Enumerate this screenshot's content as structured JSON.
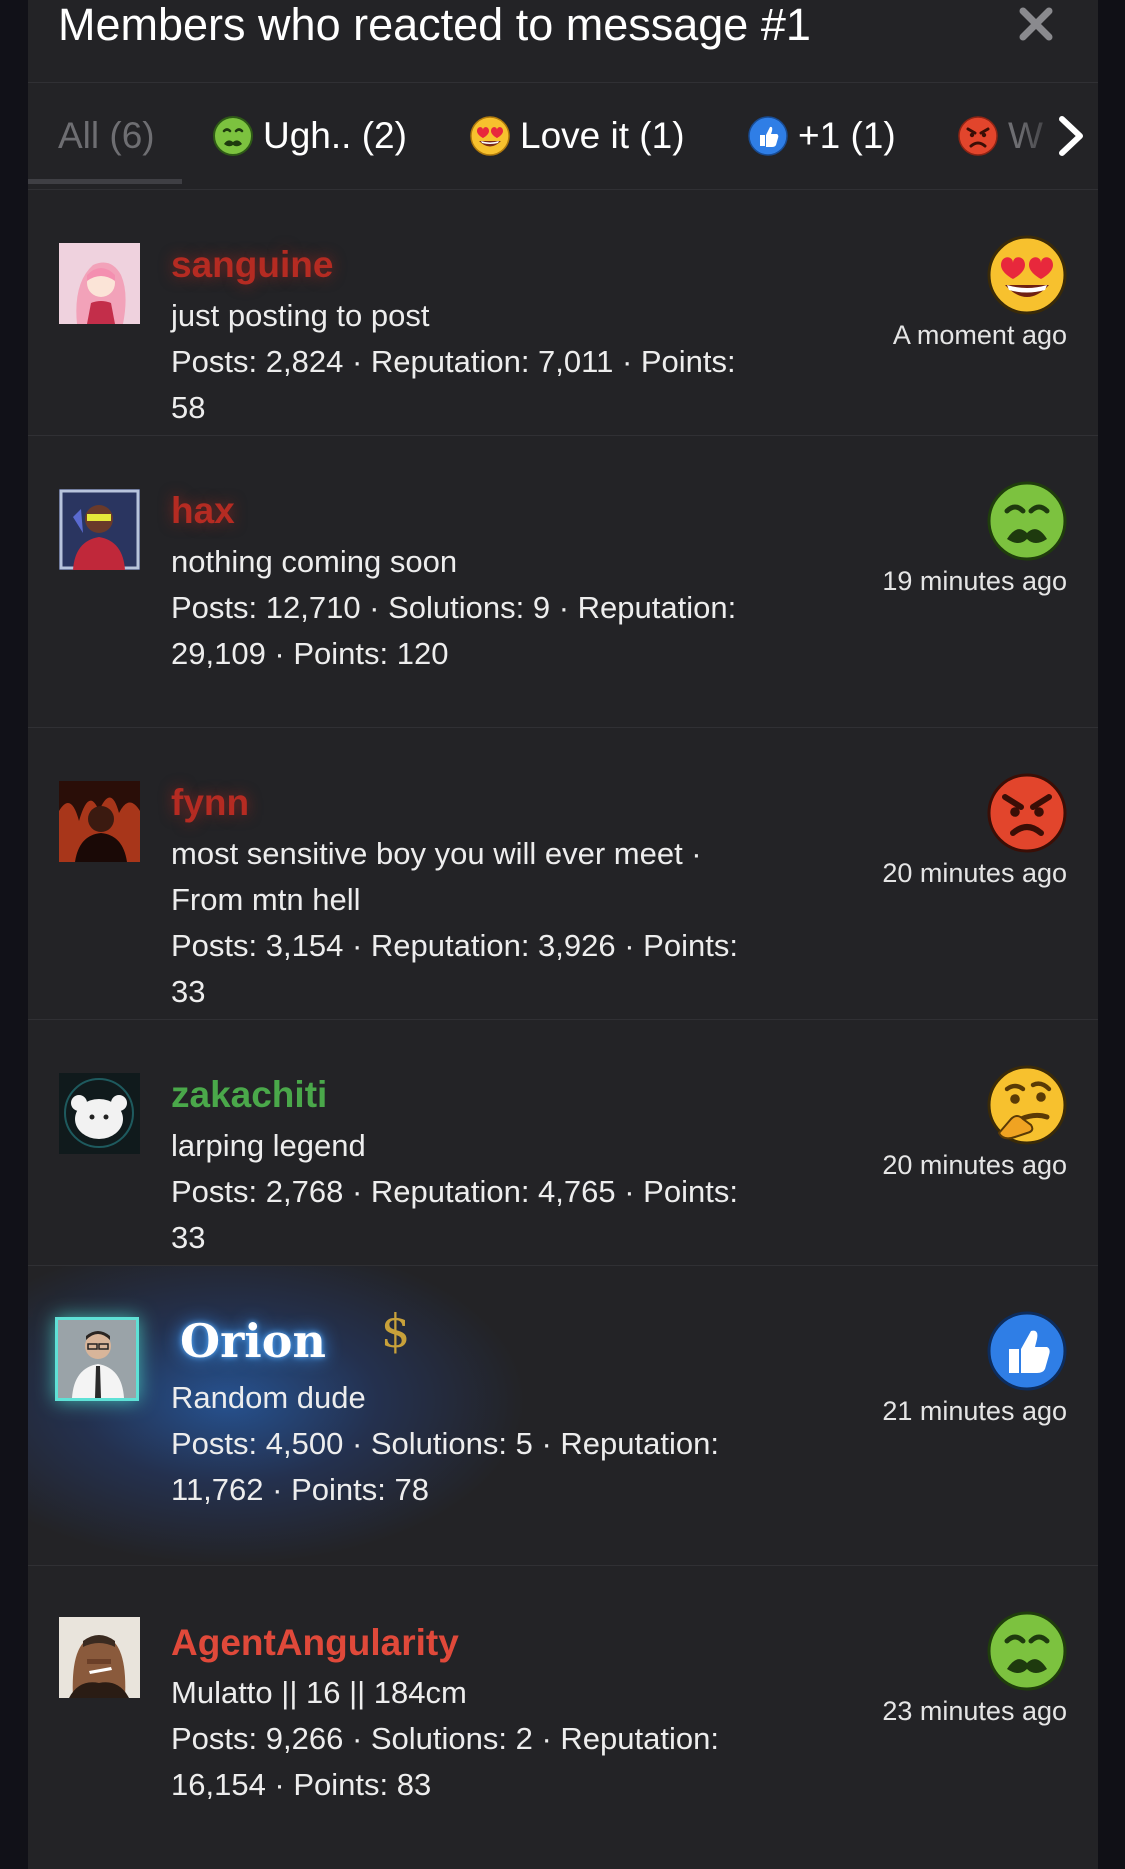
{
  "modal": {
    "title": "Members who reacted to message #1"
  },
  "tabs": [
    {
      "label": "All (6)",
      "icon": "all",
      "active": true
    },
    {
      "label": "Ugh.. (2)",
      "icon": "sick-face-icon"
    },
    {
      "label": "Love it (1)",
      "icon": "heart-eyes-icon"
    },
    {
      "label": "+1 (1)",
      "icon": "thumbs-up-icon"
    },
    {
      "label": "W",
      "icon": "angry-face-icon"
    }
  ],
  "members": [
    {
      "username": "sanguine",
      "title": "just posting to post",
      "stats": "Posts: 2,824 · Reputation: 7,011 · Points: 58",
      "time": "A moment ago",
      "reaction": "heart-eyes-icon",
      "name_color": "#b52b22"
    },
    {
      "username": "hax",
      "title": "nothing coming soon",
      "stats": "Posts: 12,710 · Solutions: 9 · Reputation: 29,109 · Points: 120",
      "time": "19 minutes ago",
      "reaction": "sick-face-icon",
      "name_color": "#b52b22"
    },
    {
      "username": "fynn",
      "title": "most sensitive boy you will ever meet · From mtn hell",
      "stats": "Posts: 3,154 · Reputation: 3,926 · Points: 33",
      "time": "20 minutes ago",
      "reaction": "angry-face-icon",
      "name_color": "#b52b22"
    },
    {
      "username": "zakachiti",
      "title": "larping legend",
      "stats": "Posts: 2,768 · Reputation: 4,765 · Points: 33",
      "time": "20 minutes ago",
      "reaction": "thinking-face-icon",
      "name_color": "#4aa84a"
    },
    {
      "username": "Orion",
      "title": "Random dude",
      "stats": "Posts: 4,500 · Solutions: 5 · Reputation: 11,762 · Points: 78",
      "time": "21 minutes ago",
      "reaction": "thumbs-up-icon",
      "name_color": "#ffffff",
      "badge": "$"
    },
    {
      "username": "AgentAngularity",
      "title": "Mulatto || 16 || 184cm",
      "stats": "Posts: 9,266 · Solutions: 2 · Reputation: 16,154 · Points: 83",
      "time": "23 minutes ago",
      "reaction": "sick-face-icon",
      "name_color": "#e0493a"
    }
  ]
}
